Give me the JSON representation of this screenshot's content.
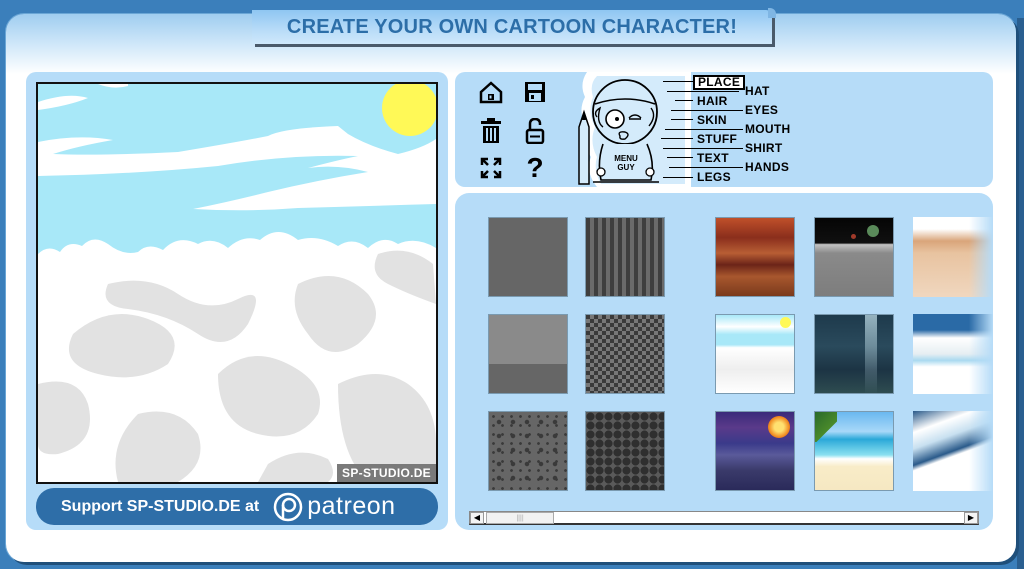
{
  "title": "CREATE YOUR OWN CARTOON CHARACTER!",
  "canvas": {
    "scene": "sky-with-clouds",
    "watermark": "SP-STUDIO.DE"
  },
  "patreon": {
    "label": "Support SP-STUDIO.DE at",
    "brand": "patreon"
  },
  "toolbar": {
    "tools": [
      {
        "name": "home",
        "icon": "home-icon"
      },
      {
        "name": "save",
        "icon": "floppy-disk-icon"
      },
      {
        "name": "delete",
        "icon": "trash-icon"
      },
      {
        "name": "unlock",
        "icon": "unlock-icon"
      },
      {
        "name": "fullscreen",
        "icon": "expand-icon"
      },
      {
        "name": "help",
        "icon": "question-icon",
        "glyph": "?"
      }
    ]
  },
  "menu_guy": {
    "shirt_line1": "MENU",
    "shirt_line2": "GUY"
  },
  "categories": {
    "left": [
      "PLACE",
      "HAIR",
      "SKIN",
      "STUFF",
      "TEXT",
      "LEGS"
    ],
    "right": [
      "HAT",
      "EYES",
      "MOUTH",
      "SHIRT",
      "HANDS"
    ],
    "active": "PLACE"
  },
  "items": [
    {
      "id": "gray-plain"
    },
    {
      "id": "gray-stripes"
    },
    {
      "id": "mars-landscape"
    },
    {
      "id": "moon-surface"
    },
    {
      "id": "desert-dunes"
    },
    {
      "id": "gray-two-tone"
    },
    {
      "id": "gray-checker"
    },
    {
      "id": "sky-clouds"
    },
    {
      "id": "underwater-light"
    },
    {
      "id": "arctic-ice"
    },
    {
      "id": "gray-dots"
    },
    {
      "id": "gray-diamonds"
    },
    {
      "id": "meteor-night"
    },
    {
      "id": "tropical-beach"
    },
    {
      "id": "snowy-mountain"
    }
  ],
  "colors": {
    "background": "#3b7fbb",
    "panel": "#b6dcf8",
    "title_text": "#2c6ea8",
    "patreon_button": "#2e6ea8",
    "sky": "#a8e8f8",
    "sun": "#fff957"
  }
}
